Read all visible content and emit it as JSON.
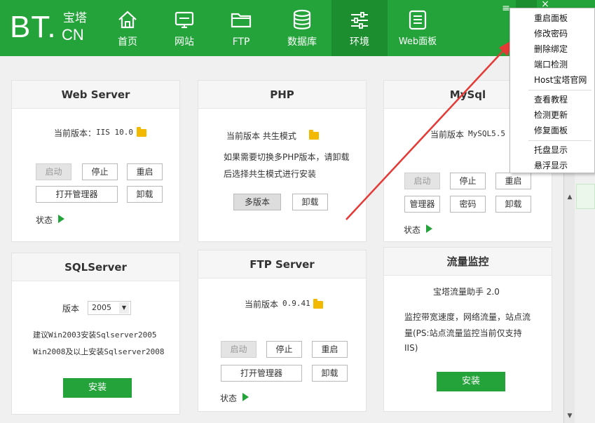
{
  "logo": {
    "bt": "BT.",
    "zh": "宝塔",
    "en": "CN"
  },
  "nav": [
    {
      "label": "首页",
      "icon": "home-icon"
    },
    {
      "label": "网站",
      "icon": "monitor-icon"
    },
    {
      "label": "FTP",
      "icon": "folder-icon"
    },
    {
      "label": "数据库",
      "icon": "database-icon"
    },
    {
      "label": "环境",
      "icon": "sliders-icon",
      "active": true
    },
    {
      "label": "Web面板",
      "icon": "list-icon"
    }
  ],
  "window": {
    "menu_glyph": "≡",
    "close_glyph": "×"
  },
  "web_server": {
    "title": "Web Server",
    "version_label": "当前版本：",
    "version": "IIS 10.0",
    "btn_start": "启动",
    "btn_stop": "停止",
    "btn_restart": "重启",
    "btn_manager": "打开管理器",
    "btn_uninstall": "卸载",
    "status_label": "状态"
  },
  "php": {
    "title": "PHP",
    "version_label": "当前版本 共生模式",
    "note_line1": "如果需要切换多PHP版本，请卸载",
    "note_line2": "后选择共生模式进行安装",
    "btn_multi": "多版本",
    "btn_uninstall": "卸载"
  },
  "mysql": {
    "title": "MySql",
    "version_label": "当前版本",
    "version": "MySQL5.5",
    "btn_start": "启动",
    "btn_stop": "停止",
    "btn_restart": "重启",
    "btn_manager": "管理器",
    "btn_password": "密码",
    "btn_uninstall": "卸载",
    "status_label": "状态"
  },
  "sqlserver": {
    "title": "SQLServer",
    "version_label": "版本",
    "version_selected": "2005",
    "note_line1": "建议Win2003安装Sqlserver2005",
    "note_line2": "Win2008及以上安装Sqlserver2008",
    "btn_install": "安装"
  },
  "ftp_server": {
    "title": "FTP Server",
    "version_label": "当前版本",
    "version": "0.9.41",
    "btn_start": "启动",
    "btn_stop": "停止",
    "btn_restart": "重启",
    "btn_manager": "打开管理器",
    "btn_uninstall": "卸载",
    "status_label": "状态"
  },
  "traffic": {
    "title": "流量监控",
    "subtitle": "宝塔流量助手 2.0",
    "desc_line1": "监控带宽速度，网络流量，站点流",
    "desc_line2": "量(PS:站点流量监控当前仅支持",
    "desc_line3": "IIS)",
    "btn_install": "安装"
  },
  "menu": {
    "items_top": [
      "重启面板",
      "修改密码",
      "删除绑定",
      "端口检测",
      "Host宝塔官网"
    ],
    "items_mid": [
      "查看教程",
      "检测更新",
      "修复面板"
    ],
    "items_bottom": [
      "托盘显示",
      "悬浮显示"
    ]
  },
  "colors": {
    "brand": "#23a33a",
    "brand_dark": "#1c8e30",
    "arrow": "#e53935",
    "folder": "#f2b900"
  }
}
